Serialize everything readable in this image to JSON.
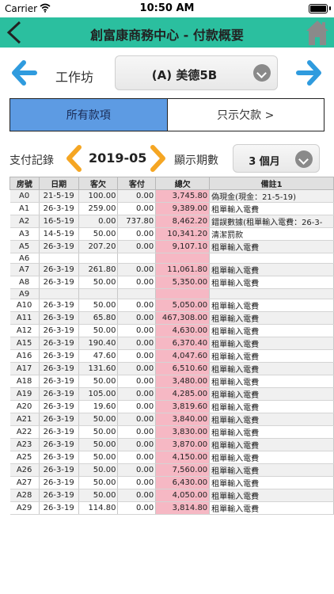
{
  "status_bar": {
    "carrier": "Carrier",
    "time": "10:50 AM"
  },
  "header": {
    "title": "創富康商務中心 - 付款概要"
  },
  "workshop": {
    "label": "工作坊",
    "selected": "(A) 美德5B"
  },
  "tabs": [
    {
      "label": "所有款項",
      "active": true
    },
    {
      "label": "只示欠款 >",
      "active": false
    }
  ],
  "payment": {
    "record_label": "支付記錄",
    "month": "2019-05",
    "period_label": "顯示期數",
    "period_selected": "3 個月"
  },
  "table": {
    "headers": [
      "房號",
      "日期",
      "客欠",
      "客付",
      "總欠",
      "備註1"
    ],
    "rows": [
      [
        "A0",
        "21-5-19",
        "100.00",
        "0.00",
        "3,745.80",
        "偽現金(現金：21-5-19)"
      ],
      [
        "A1",
        "26-3-19",
        "259.00",
        "0.00",
        "9,389.00",
        "租單輸入電費"
      ],
      [
        "A2",
        "16-5-19",
        "0.00",
        "737.80",
        "8,462.20",
        "錯誤數據(租單輸入電費：26-3-"
      ],
      [
        "A3",
        "14-5-19",
        "50.00",
        "0.00",
        "10,341.20",
        "清潔罰款"
      ],
      [
        "A5",
        "26-3-19",
        "207.20",
        "0.00",
        "9,107.10",
        "租單輸入電費"
      ],
      [
        "A6",
        "",
        "",
        "",
        "",
        ""
      ],
      [
        "A7",
        "26-3-19",
        "261.80",
        "0.00",
        "11,061.80",
        "租單輸入電費"
      ],
      [
        "A8",
        "26-3-19",
        "50.00",
        "0.00",
        "5,350.00",
        "租單輸入電費"
      ],
      [
        "A9",
        "",
        "",
        "",
        "",
        ""
      ],
      [
        "A10",
        "26-3-19",
        "50.00",
        "0.00",
        "5,050.00",
        "租單輸入電費"
      ],
      [
        "A11",
        "26-3-19",
        "65.80",
        "0.00",
        "467,308.00",
        "租單輸入電費"
      ],
      [
        "A12",
        "26-3-19",
        "50.00",
        "0.00",
        "4,630.00",
        "租單輸入電費"
      ],
      [
        "A15",
        "26-3-19",
        "190.40",
        "0.00",
        "6,370.40",
        "租單輸入電費"
      ],
      [
        "A16",
        "26-3-19",
        "47.60",
        "0.00",
        "4,047.60",
        "租單輸入電費"
      ],
      [
        "A17",
        "26-3-19",
        "131.60",
        "0.00",
        "6,510.60",
        "租單輸入電費"
      ],
      [
        "A18",
        "26-3-19",
        "50.00",
        "0.00",
        "3,480.00",
        "租單輸入電費"
      ],
      [
        "A19",
        "26-3-19",
        "105.00",
        "0.00",
        "4,285.00",
        "租單輸入電費"
      ],
      [
        "A20",
        "26-3-19",
        "19.60",
        "0.00",
        "3,819.60",
        "租單輸入電費"
      ],
      [
        "A21",
        "26-3-19",
        "50.00",
        "0.00",
        "3,840.00",
        "租單輸入電費"
      ],
      [
        "A22",
        "26-3-19",
        "50.00",
        "0.00",
        "3,830.00",
        "租單輸入電費"
      ],
      [
        "A23",
        "26-3-19",
        "50.00",
        "0.00",
        "3,870.00",
        "租單輸入電費"
      ],
      [
        "A25",
        "26-3-19",
        "50.00",
        "0.00",
        "4,150.00",
        "租單輸入電費"
      ],
      [
        "A26",
        "26-3-19",
        "50.00",
        "0.00",
        "7,560.00",
        "租單輸入電費"
      ],
      [
        "A27",
        "26-3-19",
        "50.00",
        "0.00",
        "6,430.00",
        "租單輸入電費"
      ],
      [
        "A28",
        "26-3-19",
        "50.00",
        "0.00",
        "4,050.00",
        "租單輸入電費"
      ],
      [
        "A29",
        "26-3-19",
        "114.80",
        "0.00",
        "3,814.80",
        "租單輸入電費"
      ]
    ]
  },
  "colors": {
    "header_bar": "#2bbf9f",
    "nav_arrow_blue": "#2f9bde",
    "month_arrow_orange": "#f5a623",
    "tab_active": "#5d9be3",
    "total_highlight": "#f6b8c4"
  },
  "icons": {
    "back": "chevron-left-icon",
    "home": "home-icon",
    "prev": "arrow-left-icon",
    "next": "arrow-right-icon",
    "dropdown": "chevron-down-icon"
  }
}
